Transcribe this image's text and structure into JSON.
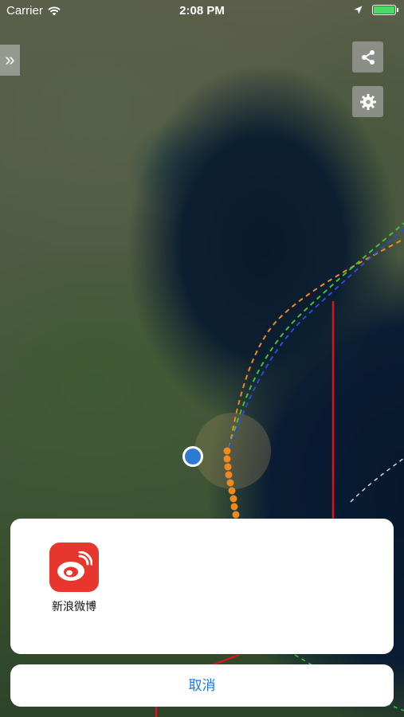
{
  "status_bar": {
    "carrier": "Carrier",
    "time": "2:08 PM"
  },
  "map": {
    "expand_icon": "double-chevron-right-icon",
    "share_icon": "share-icon",
    "settings_icon": "gear-icon"
  },
  "share_sheet": {
    "items": [
      {
        "label": "新浪微博",
        "icon": "weibo-icon",
        "color": "#e6362d"
      }
    ],
    "cancel_label": "取消"
  },
  "colors": {
    "accent": "#1678f1",
    "track_orange": "#f08a1e",
    "track_green": "#3ec23e",
    "track_blue": "#2c4bd6",
    "warning_line_red": "#d9141b",
    "battery": "#4cd964"
  }
}
